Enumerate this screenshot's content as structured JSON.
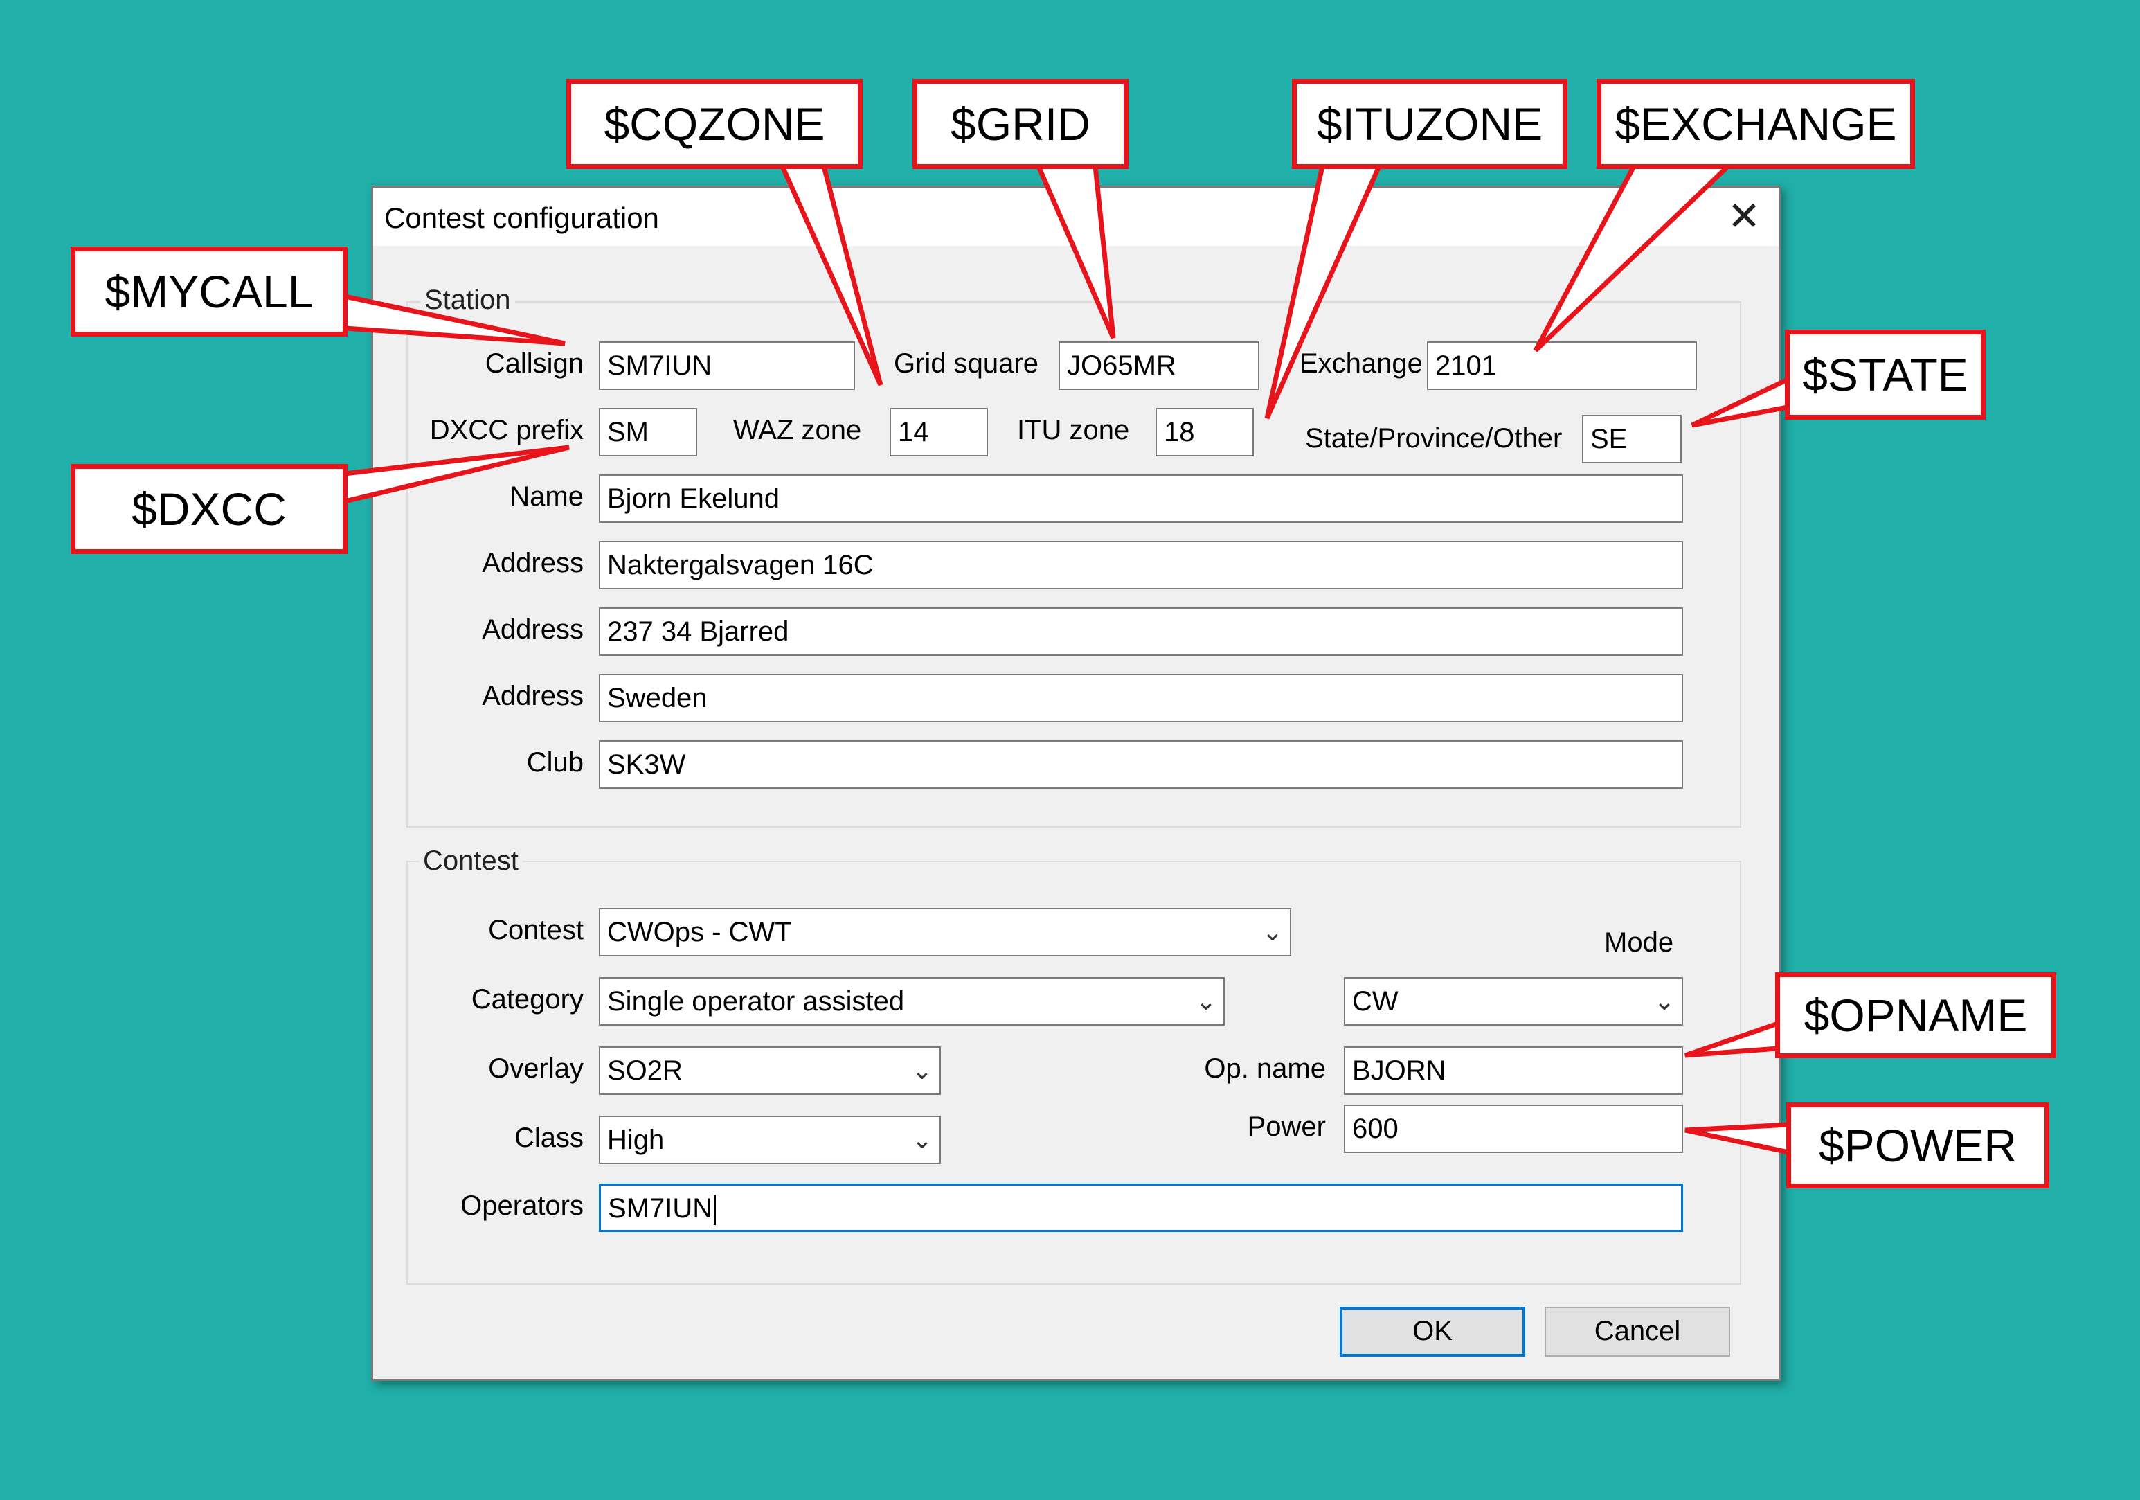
{
  "dialog": {
    "title": "Contest configuration",
    "close_glyph": "✕"
  },
  "station": {
    "group_label": "Station",
    "callsign_label": "Callsign",
    "callsign": "SM7IUN",
    "grid_label": "Grid square",
    "grid": "JO65MR",
    "exchange_label": "Exchange",
    "exchange": "2101",
    "dxcc_label": "DXCC prefix",
    "dxcc": "SM",
    "waz_label": "WAZ zone",
    "waz": "14",
    "itu_label": "ITU zone",
    "itu": "18",
    "state_label": "State/Province/Other",
    "state": "SE",
    "name_label": "Name",
    "name": "Bjorn Ekelund",
    "address_label": "Address",
    "address1": "Naktergalsvagen 16C",
    "address2": "237 34 Bjarred",
    "address3": "Sweden",
    "club_label": "Club",
    "club": "SK3W"
  },
  "contest": {
    "group_label": "Contest",
    "contest_label": "Contest",
    "contest": "CWOps - CWT",
    "mode_label": "Mode",
    "mode": "CW",
    "category_label": "Category",
    "category": "Single operator assisted",
    "overlay_label": "Overlay",
    "overlay": "SO2R",
    "opname_label": "Op. name",
    "opname": "BJORN",
    "class_label": "Class",
    "class": "High",
    "power_label": "Power",
    "power": "600",
    "operators_label": "Operators",
    "operators": "SM7IUN"
  },
  "buttons": {
    "ok": "OK",
    "cancel": "Cancel"
  },
  "callouts": {
    "cqzone": "$CQZONE",
    "grid": "$GRID",
    "ituzone": "$ITUZONE",
    "exchange": "$EXCHANGE",
    "mycall": "$MYCALL",
    "dxcc": "$DXCC",
    "state": "$STATE",
    "opname": "$OPNAME",
    "power": "$POWER"
  },
  "colors": {
    "background": "#21AFA9",
    "callout_border": "#E8141B",
    "focus": "#0078D7"
  },
  "icons": {
    "dropdown": "chevron-down-icon",
    "close": "close-icon"
  }
}
